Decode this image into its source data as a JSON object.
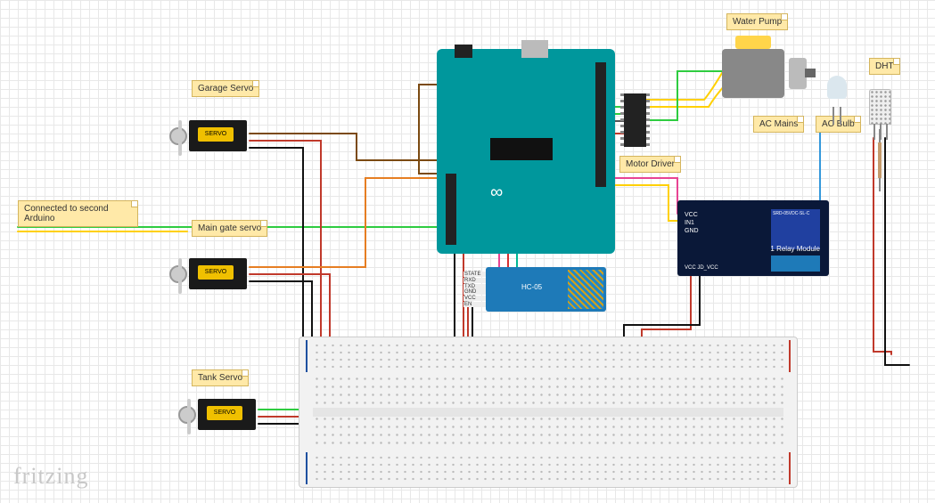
{
  "labels": {
    "garage_servo": "Garage Servo",
    "main_gate_servo": "Main gate servo",
    "tank_servo": "Tank Servo",
    "second_arduino": "Connected to second\nArduino",
    "water_pump": "Water Pump",
    "ac_mains": "AC Mains",
    "ac_bulb": "AC Bulb",
    "dht": "DHT",
    "motor_driver": "Motor Driver"
  },
  "servo_sticker": "SERVO",
  "arduino": {
    "brand": "∞"
  },
  "relay": {
    "pins": "VCC\nIN1\nGND",
    "title": "1 Relay Module",
    "model": "SRD-05VDC-SL-C",
    "footer": "VCC  JD_VCC"
  },
  "bluetooth": {
    "pins": [
      "STATE",
      "RXD",
      "TXD",
      "GND",
      "VCC",
      "EN"
    ],
    "model": "HC-05"
  },
  "watermark": "fritzing"
}
